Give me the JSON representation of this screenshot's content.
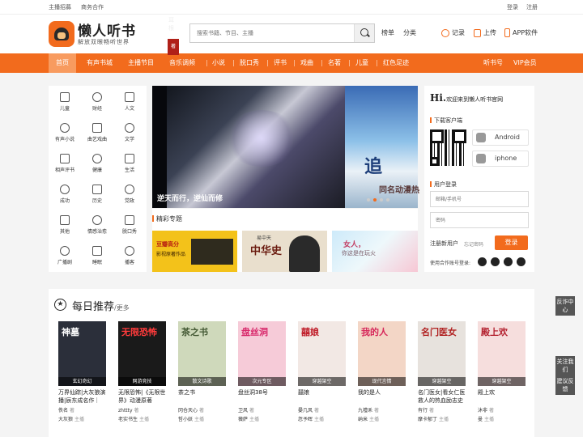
{
  "topbar": {
    "links_left": [
      "主播招募",
      "商务合作"
    ],
    "links_right": [
      "登录",
      "注册"
    ]
  },
  "header": {
    "logo_title": "懒人听书",
    "logo_sub": "解放双眼畅听世界",
    "search_placeholder": "搜索书籍、节目、主播",
    "links": [
      "榜单",
      "分类"
    ],
    "tools": [
      {
        "label": "记录",
        "icon": "clock-icon"
      },
      {
        "label": "上传",
        "icon": "upload-icon"
      },
      {
        "label": "APP软件",
        "icon": "phone-icon"
      }
    ]
  },
  "nav": {
    "items": [
      "首页",
      "有声书城",
      "主播节目",
      "音乐调频",
      "小说",
      "脱口秀",
      "评书",
      "戏曲",
      "名著",
      "儿童",
      "红色足迹"
    ],
    "right_items": [
      "听书号",
      "VIP会员"
    ],
    "active": "首页"
  },
  "categories": [
    {
      "label": "儿童",
      "icon": "child-icon"
    },
    {
      "label": "财经",
      "icon": "finance-icon"
    },
    {
      "label": "人文",
      "icon": "book-icon"
    },
    {
      "label": "有声小说",
      "icon": "novel-icon"
    },
    {
      "label": "曲艺戏曲",
      "icon": "opera-icon"
    },
    {
      "label": "文学",
      "icon": "literature-icon"
    },
    {
      "label": "相声评书",
      "icon": "crosstalk-icon"
    },
    {
      "label": "健康",
      "icon": "health-icon"
    },
    {
      "label": "生活",
      "icon": "coffee-icon"
    },
    {
      "label": "成功",
      "icon": "success-icon"
    },
    {
      "label": "历史",
      "icon": "history-icon"
    },
    {
      "label": "党政",
      "icon": "party-icon"
    },
    {
      "label": "其他",
      "icon": "other-icon"
    },
    {
      "label": "情感治愈",
      "icon": "heart-icon"
    },
    {
      "label": "脱口秀",
      "icon": "talkshow-icon"
    },
    {
      "label": "广播剧",
      "icon": "radio-icon"
    },
    {
      "label": "睡眠",
      "icon": "sleep-icon"
    },
    {
      "label": "播客",
      "icon": "podcast-icon"
    }
  ],
  "banner": {
    "slogan": "逆天而行，逆仙而修",
    "author": "耳根",
    "seal": "著",
    "side_title": "追",
    "side_text": "同名动漫热",
    "dots": 4,
    "active_dot": 1
  },
  "featured": {
    "title": "精彩专题",
    "items": [
      {
        "text": "豆瓣高分",
        "sub": "影视原著作品"
      },
      {
        "text": "中华史",
        "sub": "易中天"
      },
      {
        "text": "女人，",
        "sub": "你这是在玩火"
      }
    ]
  },
  "panel": {
    "greeting": "Hi.",
    "welcome": "欢迎来到懒人听书官网",
    "download_title": "下载客户端",
    "android": "Android",
    "iphone": "iphone",
    "login_title": "用户登录",
    "email_placeholder": "邮箱/手机号",
    "password_placeholder": "密码",
    "register": "注册新用户",
    "forgot": "忘记密码",
    "login_btn": "登录",
    "coop_login": "使用合作账号登录:"
  },
  "daily": {
    "title": "每日推荐",
    "more": "/更多",
    "books": [
      {
        "cover_text": "神墓",
        "tag": "玄幻奇幻",
        "name": "万界仙踪|大灰狼演播|辰东成名作｜动…",
        "author": "佚名",
        "host": "大灰狼",
        "bg": "#2b2f3a",
        "fg": "#ffffff"
      },
      {
        "cover_text": "无限恐怖",
        "tag": "网游竞技",
        "name": "无限恐怖|《无限世界》动漫原著",
        "author": "zhttty",
        "host": "老实书生",
        "bg": "#1a1a1a",
        "fg": "#ff3b3b"
      },
      {
        "cover_text": "茶之书",
        "tag": "散文诗歌",
        "name": "茶之书",
        "author": "冈仓天心",
        "host": "哲小妖",
        "bg": "#cfd9bb",
        "fg": "#455a35"
      },
      {
        "cover_text": "盘丝洞",
        "tag": "次元专区",
        "name": "盘丝洞38号",
        "author": "卫风",
        "host": "薇萨",
        "bg": "#f6cbd8",
        "fg": "#d8296b"
      },
      {
        "cover_text": "囍娘",
        "tag": "穿越架空",
        "name": "囍娘",
        "author": "晏几风",
        "host": "忽予晖",
        "bg": "#f2e8e4",
        "fg": "#c01e2a"
      },
      {
        "cover_text": "我的人",
        "tag": "现代言情",
        "name": "我的是人",
        "author": "九禮禾",
        "host": "纳米",
        "bg": "#f3d6c6",
        "fg": "#d6285a"
      },
      {
        "cover_text": "名门医女",
        "tag": "穿越架空",
        "name": "名门医女|看女仁医救人的热血励志史",
        "author": "有行",
        "host": "摩卡郁丁",
        "bg": "#e7e2dd",
        "fg": "#b01f1f"
      },
      {
        "cover_text": "殿上欢",
        "tag": "穿越架空",
        "name": "殿上欢",
        "author": "沐非",
        "host": "曼",
        "bg": "#f6dedd",
        "fg": "#b3202e"
      }
    ]
  },
  "floats": [
    "反诈中心",
    "关注我们",
    "建议反馈"
  ],
  "labels": {
    "author_suffix": "著",
    "host_suffix": "主播"
  }
}
